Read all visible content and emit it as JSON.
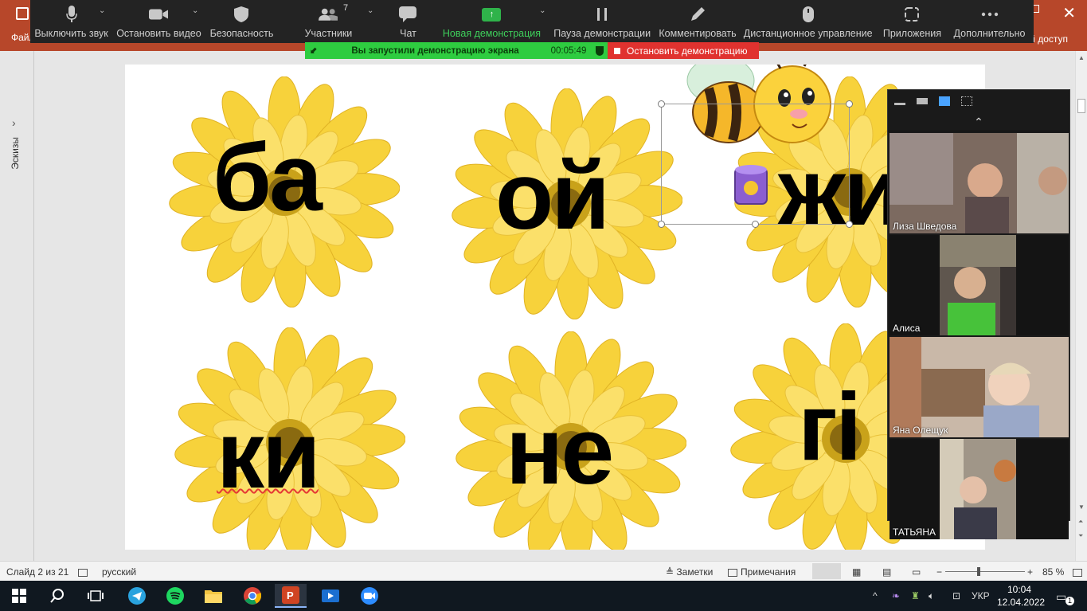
{
  "powerpoint": {
    "file_label": "Файл",
    "share_label": "й доступ",
    "slide_status": "Слайд 2 из 21",
    "language": "русский",
    "notes_label": "Заметки",
    "comments_label": "Примечания",
    "zoom_percent": "85 %",
    "thumbnails_label": "Эскизы"
  },
  "zoom_toolbar": {
    "items": [
      {
        "label": "Выключить звук",
        "icon": "microphone-icon"
      },
      {
        "label": "Остановить видео",
        "icon": "video-camera-icon"
      },
      {
        "label": "Безопасность",
        "icon": "shield-icon"
      },
      {
        "label": "Участники",
        "icon": "participants-icon",
        "count": "7"
      },
      {
        "label": "Чат",
        "icon": "chat-icon"
      },
      {
        "label": "Новая демонстрация",
        "icon": "share-screen-icon"
      },
      {
        "label": "Пауза демонстрации",
        "icon": "pause-icon"
      },
      {
        "label": "Комментировать",
        "icon": "pencil-icon"
      },
      {
        "label": "Дистанционное управление",
        "icon": "mouse-icon"
      },
      {
        "label": "Приложения",
        "icon": "apps-icon"
      },
      {
        "label": "Дополнительно",
        "icon": "more-icon"
      }
    ]
  },
  "share_status": {
    "message": "Вы запустили демонстрацию экрана",
    "timer": "00:05:49",
    "stop_label": "Остановить демонстрацию"
  },
  "slide": {
    "syllables": [
      "ба",
      "ой",
      "жи",
      "ки",
      "не",
      "гі"
    ]
  },
  "participants": [
    {
      "name": "Лиза Шведова"
    },
    {
      "name": "Алиса"
    },
    {
      "name": "Яна Олещук"
    },
    {
      "name": "ТАТЬЯНА"
    }
  ],
  "taskbar": {
    "language": "УКР",
    "time": "10:04",
    "date": "12.04.2022",
    "notification_count": "1"
  },
  "colors": {
    "zoom_green": "#2ecc40",
    "zoom_red": "#e0322f",
    "ppt_accent": "#b7472a",
    "flower_yellow": "#f7d23b"
  }
}
